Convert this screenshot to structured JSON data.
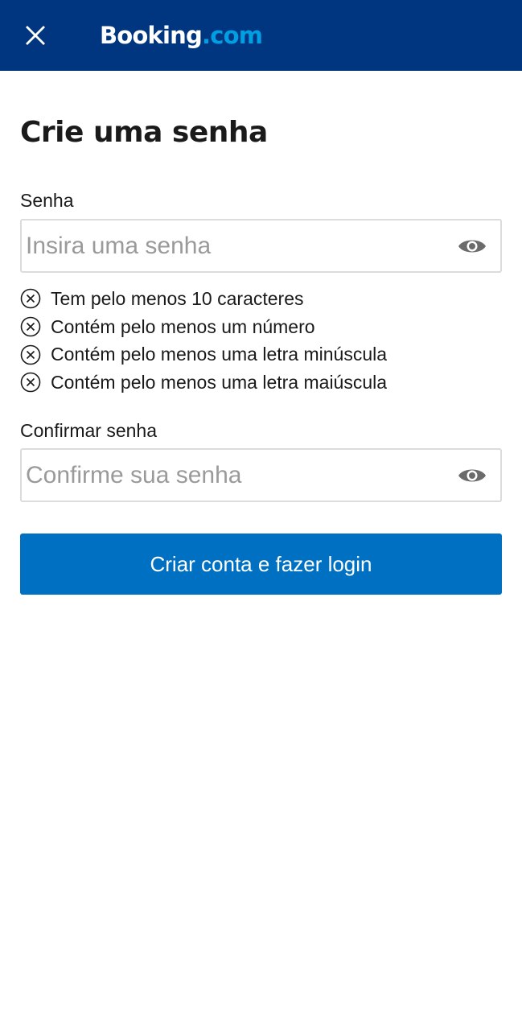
{
  "header": {
    "logo_brand": "Booking",
    "logo_tld": ".com",
    "close_icon": "close-icon",
    "background_color": "#003580"
  },
  "page": {
    "title": "Crie uma senha"
  },
  "password": {
    "label": "Senha",
    "placeholder": "Insira uma senha",
    "value": "",
    "toggle_icon": "eye-icon"
  },
  "requirements": [
    {
      "text": "Tem pelo menos 10 caracteres",
      "icon": "x-circle-icon",
      "met": false
    },
    {
      "text": "Contém pelo menos um número",
      "icon": "x-circle-icon",
      "met": false
    },
    {
      "text": "Contém pelo menos uma letra minúscula",
      "icon": "x-circle-icon",
      "met": false
    },
    {
      "text": "Contém pelo menos uma letra maiúscula",
      "icon": "x-circle-icon",
      "met": false
    }
  ],
  "confirm": {
    "label": "Confirmar senha",
    "placeholder": "Confirme sua senha",
    "value": "",
    "toggle_icon": "eye-icon"
  },
  "submit": {
    "label": "Criar conta e fazer login",
    "color": "#0071c2"
  }
}
